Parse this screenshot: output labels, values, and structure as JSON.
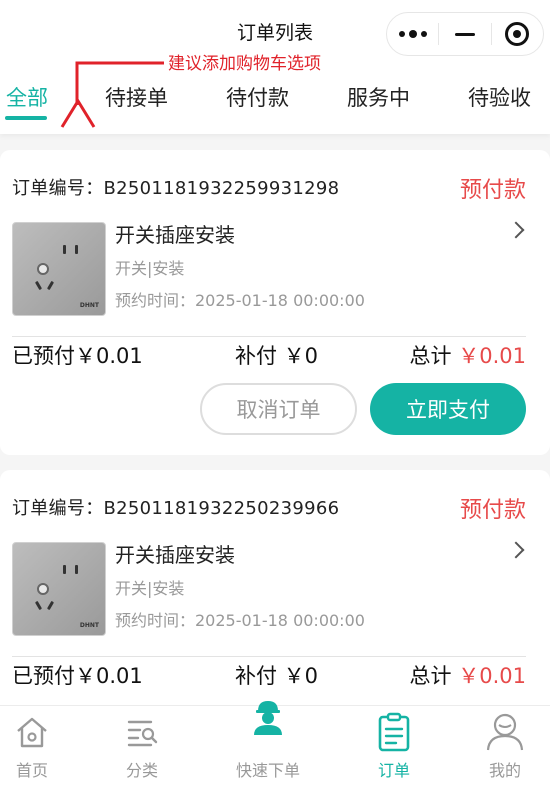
{
  "header": {
    "title": "订单列表"
  },
  "annotation": {
    "text": "建议添加购物车选项",
    "color": "#e0222a"
  },
  "tabs": [
    {
      "label": "全部",
      "active": true
    },
    {
      "label": "待接单",
      "active": false
    },
    {
      "label": "待付款",
      "active": false
    },
    {
      "label": "服务中",
      "active": false
    },
    {
      "label": "待验收",
      "active": false
    }
  ],
  "orders": [
    {
      "order_no": "订单编号：B2501181932259931298",
      "status": "预付款",
      "service_name": "开关插座安装",
      "tags": "开关|安装",
      "appointment": "预约时间：2025-01-18 00:00:00",
      "prepaid": "已预付￥0.01",
      "supplement": "补付 ￥0",
      "total_label": "总计",
      "total_amount": "￥0.01",
      "cancel_label": "取消订单",
      "pay_label": "立即支付",
      "thumb_brand": "DHNT"
    },
    {
      "order_no": "订单编号：B2501181932250239966",
      "status": "预付款",
      "service_name": "开关插座安装",
      "tags": "开关|安装",
      "appointment": "预约时间：2025-01-18 00:00:00",
      "prepaid": "已预付￥0.01",
      "supplement": "补付 ￥0",
      "total_label": "总计",
      "total_amount": "￥0.01",
      "cancel_label": "取消订单",
      "pay_label": "立即支付",
      "thumb_brand": "DHNT"
    }
  ],
  "bottom_nav": [
    {
      "label": "首页",
      "icon": "home-icon",
      "active": false
    },
    {
      "label": "分类",
      "icon": "category-icon",
      "active": false
    },
    {
      "label": "快速下单",
      "icon": "worker-icon",
      "active": false
    },
    {
      "label": "订单",
      "icon": "order-icon",
      "active": true
    },
    {
      "label": "我的",
      "icon": "profile-icon",
      "active": false
    }
  ],
  "colors": {
    "accent": "#15b3a4",
    "price": "#e74a4a"
  }
}
